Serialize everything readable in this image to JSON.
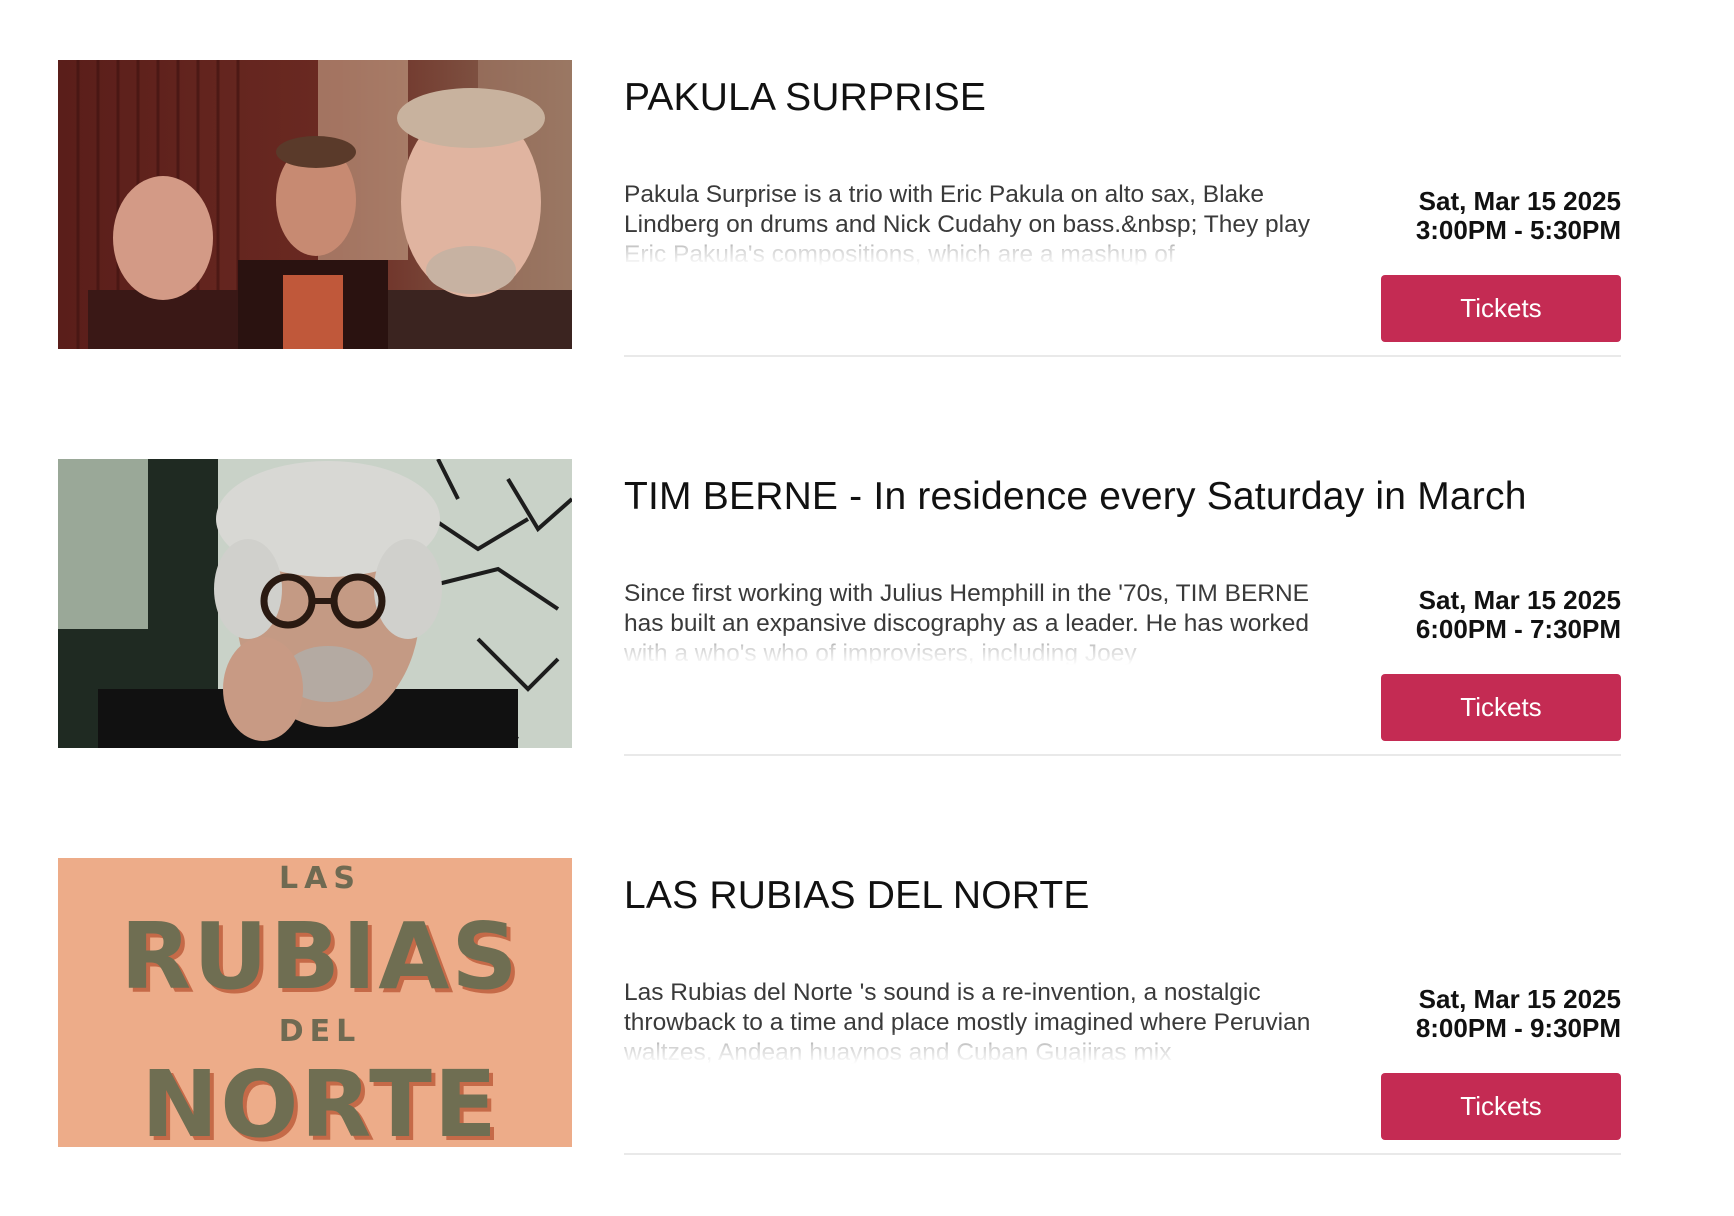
{
  "events": [
    {
      "title": "PAKULA SURPRISE",
      "description": "Pakula Surprise is a trio with Eric Pakula on alto sax, Blake Lindberg on drums and Nick Cudahy on bass.&nbsp; They play Eric Pakula's compositions, which are a mashup of",
      "date": "Sat, Mar 15 2025",
      "time": "3:00PM - 5:30PM",
      "button_label": "Tickets",
      "image_alt": "Three men posing together"
    },
    {
      "title": "TIM BERNE - In residence every Saturday in March",
      "description": "Since first working with Julius Hemphill in the '70s, TIM BERNE has built an expansive discography as a leader. He has worked with a who's who of improvisers, including Joey",
      "date": "Sat, Mar 15 2025",
      "time": "6:00PM - 7:30PM",
      "button_label": "Tickets",
      "image_alt": "Portrait of Tim Berne"
    },
    {
      "title": "LAS RUBIAS DEL NORTE",
      "description": "Las Rubias del Norte 's sound is a re-invention, a nostalgic throwback to a time and place mostly imagined where Peruvian waltzes, Andean huaynos and Cuban Guajiras mix",
      "date": "Sat, Mar 15 2025",
      "time": "8:00PM - 9:30PM",
      "button_label": "Tickets",
      "image_alt": "Las Rubias del Norte logo artwork",
      "image_text": {
        "line1": "LAS",
        "line2": "RUBIAS",
        "line3": "DEL",
        "line4": "NORTE"
      }
    }
  ],
  "colors": {
    "button": "#c42b53",
    "button_text": "#ffffff",
    "title": "#111111",
    "divider": "#e9e9e9"
  }
}
